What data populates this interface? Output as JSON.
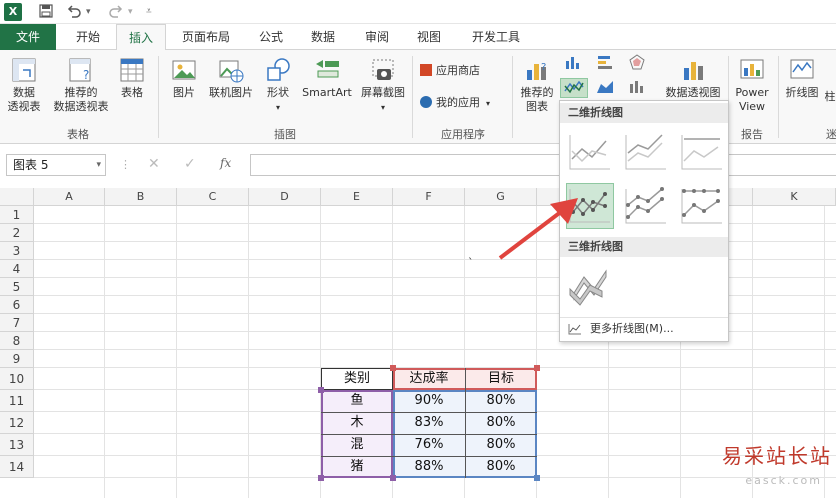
{
  "app": {
    "logo": "X",
    "quick_access": [
      "save-icon",
      "undo-icon",
      "redo-icon",
      "customize-icon"
    ]
  },
  "tabs": [
    {
      "label": "文件"
    },
    {
      "label": "开始"
    },
    {
      "label": "插入"
    },
    {
      "label": "页面布局"
    },
    {
      "label": "公式"
    },
    {
      "label": "数据"
    },
    {
      "label": "审阅"
    },
    {
      "label": "视图"
    },
    {
      "label": "开发工具"
    }
  ],
  "active_tab": "插入",
  "ribbon": {
    "pivot_line1": "数据",
    "pivot_line2": "透视表",
    "rec_pivot_line1": "推荐的",
    "rec_pivot_line2": "数据透视表",
    "table": "表格",
    "group_tables": "表格",
    "picture": "图片",
    "online_picture": "联机图片",
    "shapes": "形状",
    "smartart": "SmartArt",
    "screenshot": "屏幕截图",
    "group_illustrations": "插图",
    "app_store": "应用商店",
    "my_apps": "我的应用",
    "group_apps": "应用程序",
    "rec_charts_line1": "推荐的",
    "rec_charts_line2": "图表",
    "pivot_chart_partial": "数据透视图",
    "power_view_line1": "Power",
    "power_view_line2": "View",
    "group_reports": "报告",
    "sparkline_line": "折线图",
    "sparkline_col": "柱",
    "group_sparkline_partial": "迷"
  },
  "formula_bar": {
    "name_box": "图表 5",
    "fx_label": "fx",
    "value": ""
  },
  "columns": [
    "A",
    "B",
    "C",
    "D",
    "E",
    "F",
    "G",
    "K"
  ],
  "rows": [
    "1",
    "2",
    "3",
    "4",
    "5",
    "6",
    "7",
    "8",
    "9",
    "10",
    "11",
    "12",
    "13",
    "14"
  ],
  "table": {
    "headers": [
      "类别",
      "达成率",
      "目标"
    ],
    "rows": [
      [
        "鱼",
        "90%",
        "80%"
      ],
      [
        "木",
        "83%",
        "80%"
      ],
      [
        "混",
        "76%",
        "80%"
      ],
      [
        "猪",
        "88%",
        "80%"
      ]
    ]
  },
  "stray_mark": "`",
  "dropdown": {
    "section_2d": "二维折线图",
    "section_3d": "三维折线图",
    "more": "更多折线图(M)..."
  },
  "colors": {
    "excel_green": "#217346",
    "selected_thumb": "#cfe7d6",
    "arrow": "#e0443e",
    "col_e_border": "#8e5fa8",
    "col_f_border": "#d05a5a",
    "col_g_border": "#5b86c3"
  },
  "watermark": {
    "text": "易采站长站",
    "sub": "easck.com"
  }
}
